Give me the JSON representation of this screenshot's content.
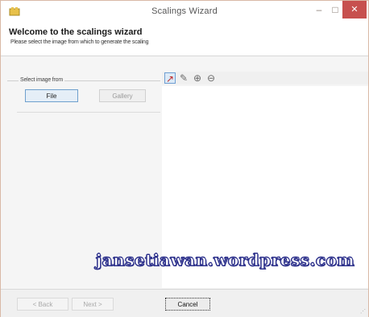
{
  "window": {
    "title": "Scalings Wizard",
    "minimize_glyph": "–",
    "maximize_glyph": "□",
    "close_glyph": "✕",
    "app_icon": "wizard-app-icon"
  },
  "header": {
    "heading": "Welcome to the scalings wizard",
    "subheading": "Please select the image from which to generate the scaling"
  },
  "source_group": {
    "label": "Select image from",
    "buttons": [
      {
        "label": "File",
        "enabled": true
      },
      {
        "label": "Gallery",
        "enabled": false
      }
    ]
  },
  "toolbar": {
    "tools": [
      {
        "icon": "select-tool-icon",
        "glyph": "↗",
        "active": true
      },
      {
        "icon": "pencil-tool-icon",
        "glyph": "✎",
        "active": false
      },
      {
        "icon": "zoom-in-tool-icon",
        "glyph": "⊕",
        "active": false
      },
      {
        "icon": "zoom-out-tool-icon",
        "glyph": "⊖",
        "active": false
      }
    ]
  },
  "watermark": "jansetiawan.wordpress.com",
  "footer": {
    "back_label": "< Back",
    "next_label": "Next >",
    "cancel_label": "Cancel"
  },
  "colors": {
    "close_button": "#c7504e",
    "watermark_outline": "#2a2e8a",
    "active_tool_border": "#6f9fd3"
  }
}
